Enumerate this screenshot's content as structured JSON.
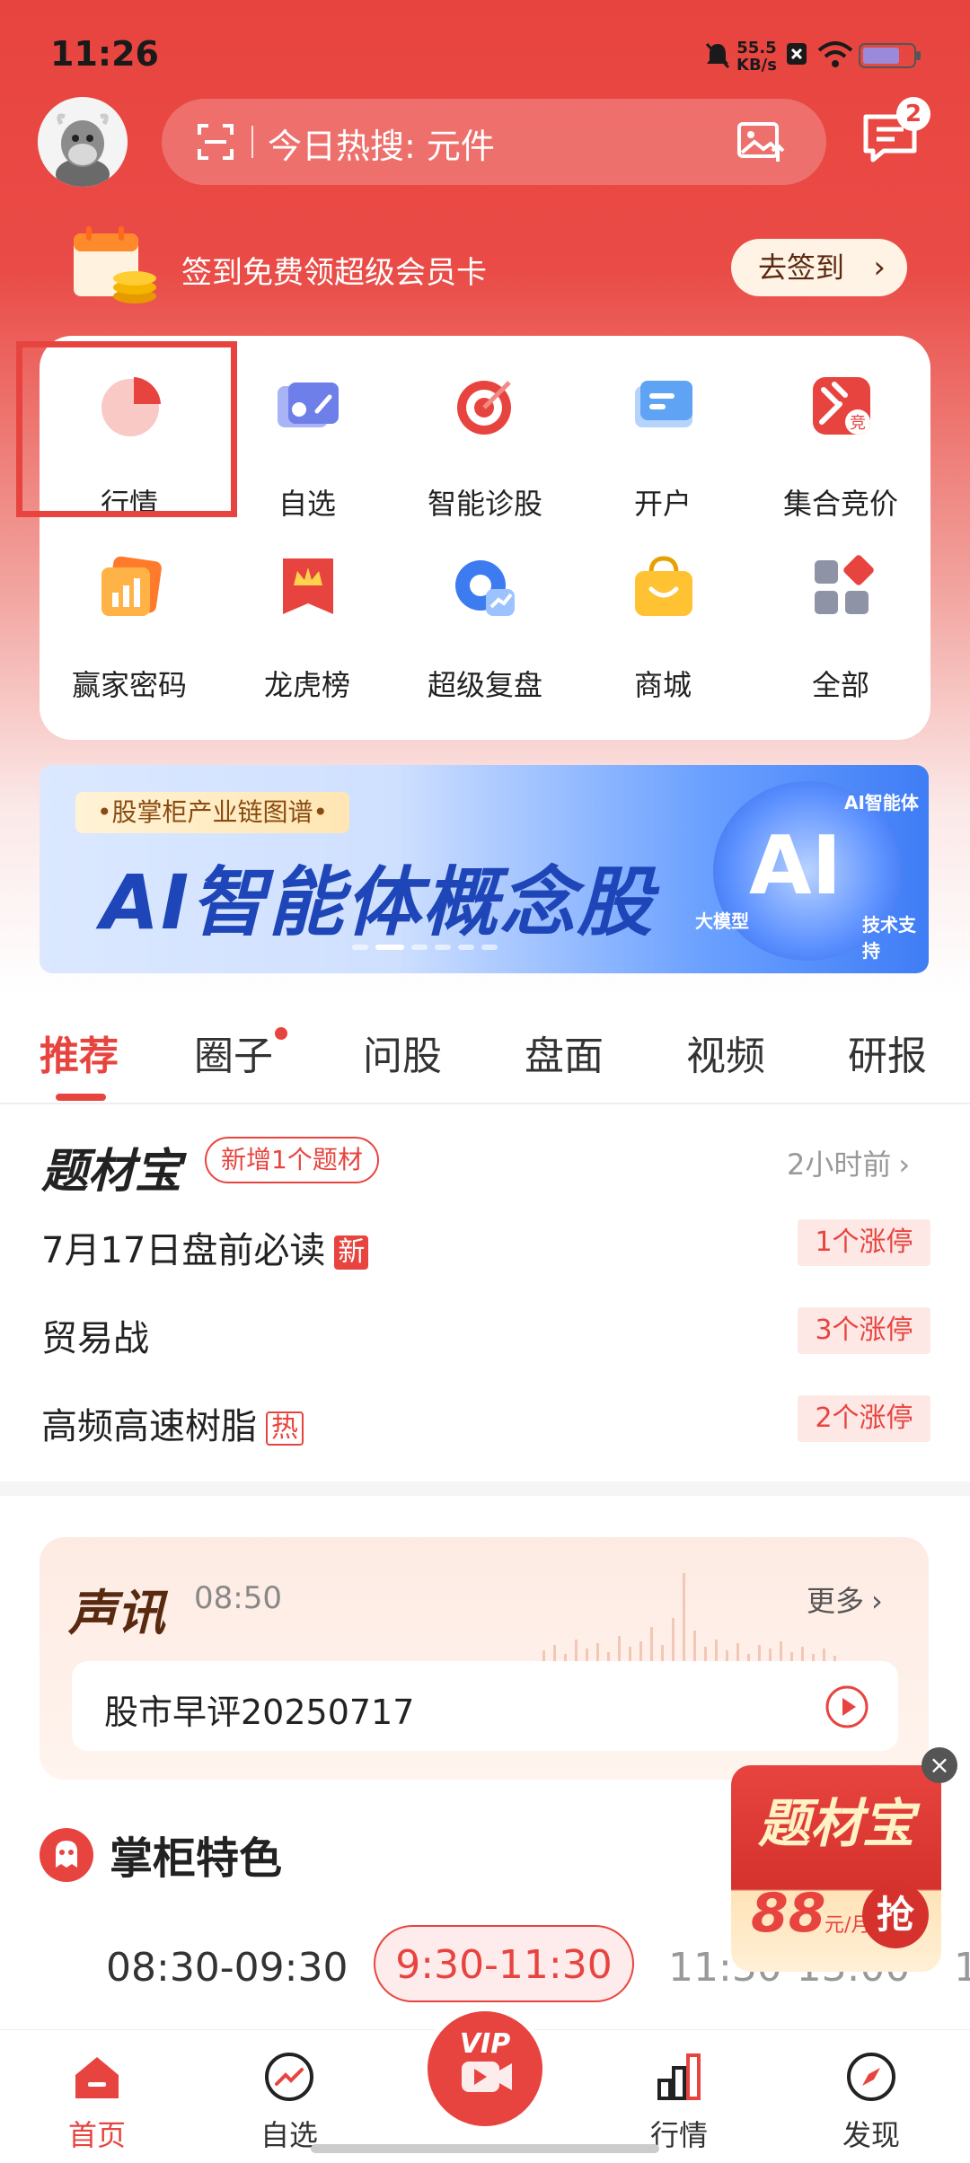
{
  "status_bar": {
    "time": "11:26",
    "net_speed": "55.5",
    "net_unit": "KB/s"
  },
  "header": {
    "search_text": "今日热搜: 元件",
    "message_badge": "2"
  },
  "signin": {
    "text": "签到免费领超级会员卡",
    "button": "去签到"
  },
  "grid": [
    {
      "label": "行情",
      "icon": "pie-chart-icon"
    },
    {
      "label": "自选",
      "icon": "watchlist-card-icon"
    },
    {
      "label": "智能诊股",
      "icon": "target-icon"
    },
    {
      "label": "开户",
      "icon": "card-icon"
    },
    {
      "label": "集合竞价",
      "icon": "gavel-icon"
    },
    {
      "label": "赢家密码",
      "icon": "bar-chart-icon"
    },
    {
      "label": "龙虎榜",
      "icon": "crown-flag-icon"
    },
    {
      "label": "超级复盘",
      "icon": "replay-icon"
    },
    {
      "label": "商城",
      "icon": "shopping-bag-icon"
    },
    {
      "label": "全部",
      "icon": "all-apps-icon"
    }
  ],
  "banner": {
    "tag": "•股掌柜产业链图谱•",
    "headline": "AI智能体概念股",
    "ai_badge": "AI",
    "small1": "AI智能体",
    "small2": "大模型",
    "small3": "技术支持"
  },
  "tabs": [
    "推荐",
    "圈子",
    "问股",
    "盘面",
    "视频",
    "研报"
  ],
  "topics": {
    "title_a": "题",
    "title_b": "材宝",
    "badge": "新增1个题材",
    "time": "2小时前",
    "rows": [
      {
        "name": "7月17日盘前必读",
        "flag": "新",
        "pill": "1个涨停"
      },
      {
        "name": "贸易战",
        "flag": "",
        "pill": "3个涨停"
      },
      {
        "name": "高频高速树脂",
        "flag": "热",
        "pill": "2个涨停"
      }
    ]
  },
  "audio": {
    "brand": "声讯",
    "time": "08:50",
    "more": "更多",
    "item": "股市早评20250717"
  },
  "float_ad": {
    "title": "题材宝",
    "price": "88",
    "unit": "元/月",
    "grab": "抢"
  },
  "featured": {
    "title": "掌柜特色",
    "slots": [
      "08:30-09:30",
      "9:30-11:30",
      "11:30-13:00",
      "1"
    ]
  },
  "bottom_nav": [
    "首页",
    "自选",
    "行情",
    "发现"
  ],
  "colors": {
    "brand_red": "#e8443f"
  }
}
